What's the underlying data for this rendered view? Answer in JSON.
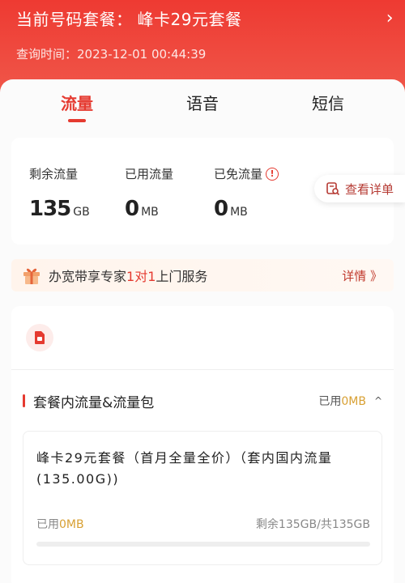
{
  "header": {
    "plan_label": "当前号码套餐：",
    "plan_name": "峰卡29元套餐",
    "query_label": "查询时间：",
    "query_time": "2023-12-01 00:44:39"
  },
  "tabs": [
    {
      "label": "流量",
      "active": true
    },
    {
      "label": "语音",
      "active": false
    },
    {
      "label": "短信",
      "active": false
    }
  ],
  "usage": {
    "remaining": {
      "label": "剩余流量",
      "value": "135",
      "unit": "GB"
    },
    "used": {
      "label": "已用流量",
      "value": "0",
      "unit": "MB"
    },
    "exempt": {
      "label": "已免流量",
      "value": "0",
      "unit": "MB"
    },
    "detail_label": "查看详单"
  },
  "promo": {
    "text_before": "办宽带享专家",
    "highlight": "1对1",
    "text_after": "上门服务",
    "more_label": "详情 》"
  },
  "section": {
    "title": "套餐内流量&流量包",
    "used_prefix": "已用",
    "used_value": "0MB",
    "caret": "^"
  },
  "package": {
    "name": "峰卡29元套餐（首月全量全价）（套内国内流量(135.00G))",
    "used_prefix": "已用",
    "used_value": "0MB",
    "remaining": "剩余135GB/共135GB",
    "progress": 0
  },
  "colors": {
    "accent": "#e53a30",
    "header_bg": "#ee3a32",
    "highlight": "#d8a033"
  }
}
